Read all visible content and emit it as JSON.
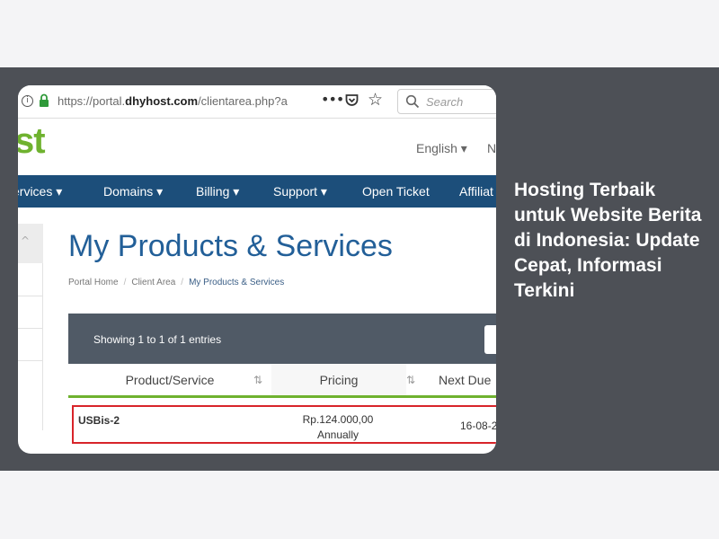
{
  "browser": {
    "url_prefix": "https://portal.",
    "url_domain": "dhyhost.com",
    "url_suffix": "/clientarea.php?a",
    "search_placeholder": "Search"
  },
  "site": {
    "logo_fragment": "st",
    "language": "English",
    "header_cut": "N",
    "nav": [
      "ervices",
      "Domains",
      "Billing",
      "Support",
      "Open Ticket",
      "Affiliat"
    ]
  },
  "page": {
    "title": "My Products & Services",
    "breadcrumb": [
      "Portal Home",
      "Client Area",
      "My Products & Services"
    ]
  },
  "table": {
    "showing": "Showing 1 to 1 of 1 entries",
    "columns": [
      "Product/Service",
      "Pricing",
      "Next Due"
    ],
    "rows": [
      {
        "product": "USBis-2",
        "price": "Rp.124.000,00",
        "cycle": "Annually",
        "due": "16-08-2"
      }
    ]
  },
  "caption": {
    "headline": "Hosting Terbaik untuk Website Berita di Indonesia: Update Cepat, Informasi Terkini"
  },
  "colors": {
    "nav_bg": "#1c4e7a",
    "title": "#225f98",
    "accent_green": "#6fb22f",
    "row_highlight": "#d8242a",
    "band": "#4d5056"
  }
}
